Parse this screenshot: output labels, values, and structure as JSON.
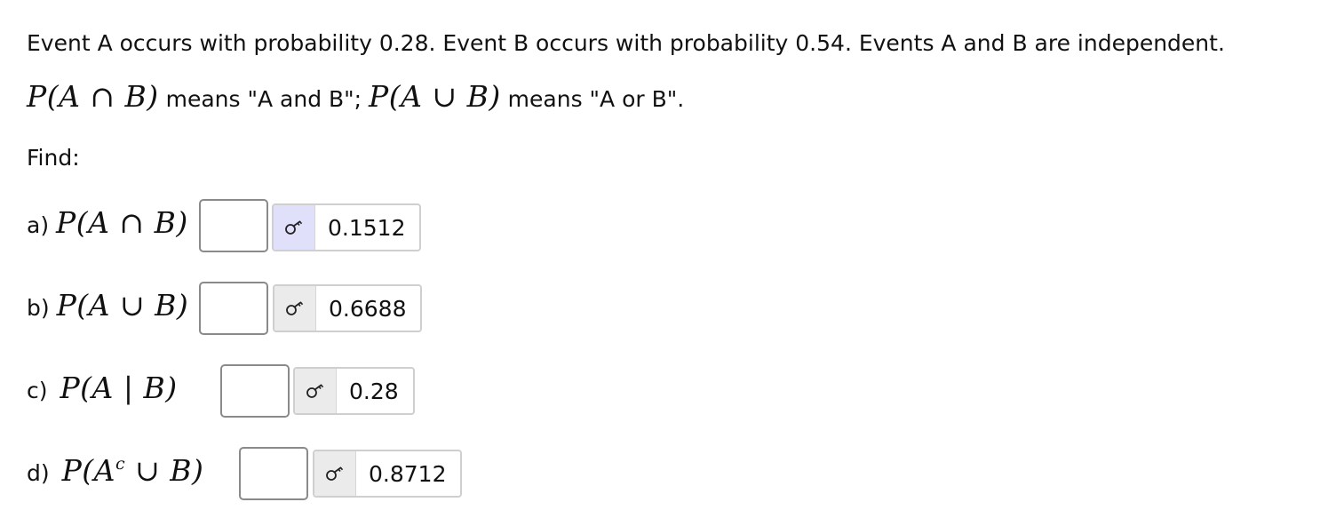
{
  "problem": {
    "statement_prefix": "Event A occurs with probability ",
    "p_a": "0.28",
    "statement_mid": ". Event B occurs with probability ",
    "p_b": "0.54",
    "statement_suffix": ". Events A and B are independent.",
    "notation_and_math": "P(A ∩ B)",
    "notation_and_text": " means \"A and B\"; ",
    "notation_or_math": "P(A ∪ B)",
    "notation_or_text": " means \"A or B\".",
    "find_label": "Find:"
  },
  "questions": [
    {
      "label": "a)",
      "expr": "P(A ∩ B)",
      "answer": "0.1512"
    },
    {
      "label": "b)",
      "expr": "P(A ∪ B)",
      "answer": "0.6688"
    },
    {
      "label": "c)",
      "expr": "P(A | B)",
      "answer": "0.28"
    },
    {
      "label": "d)",
      "expr_pre": "P(A",
      "expr_sup": "c",
      "expr_post": " ∪ B)",
      "answer": "0.8712"
    }
  ],
  "icons": {
    "answer_key": "key-icon"
  },
  "colors": {
    "key_button_bg": "#ebebeb",
    "key_button_active_bg": "#e0e0fb",
    "input_border": "#8a8a8a"
  }
}
